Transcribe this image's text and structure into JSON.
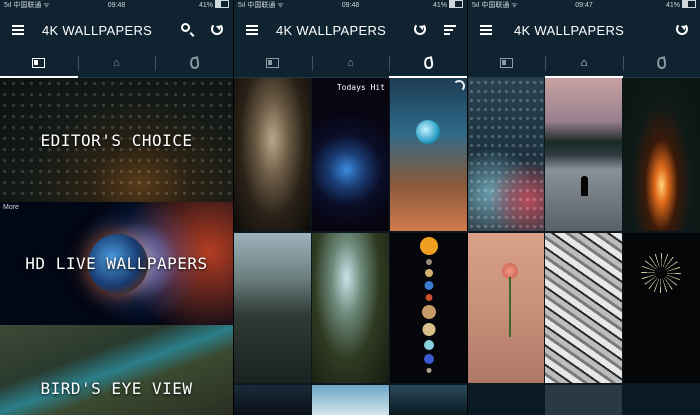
{
  "status": {
    "carrier": "5ıl 中国联通 ᯤ",
    "screen1_time": "09:48",
    "screen2_time": "09:48",
    "screen3_time": "09:47",
    "battery": "41%"
  },
  "app": {
    "title": "4K WALLPAPERS"
  },
  "tabs": {
    "editors": "book-icon",
    "home": "home-icon",
    "hot": "flame-icon"
  },
  "screen1": {
    "active_tab": "editors",
    "categories": [
      {
        "label": "EDITOR'S CHOICE"
      },
      {
        "label": "HD LIVE WALLPAPERS",
        "tag": "More"
      },
      {
        "label": "BIRD'S EYE VIEW"
      }
    ]
  },
  "screen2": {
    "active_tab": "hot",
    "hit_label": "Todays Hit"
  },
  "screen3": {
    "active_tab": "home"
  },
  "colors": {
    "appbar": "#0f2430",
    "active_indicator": "#ffffff"
  }
}
